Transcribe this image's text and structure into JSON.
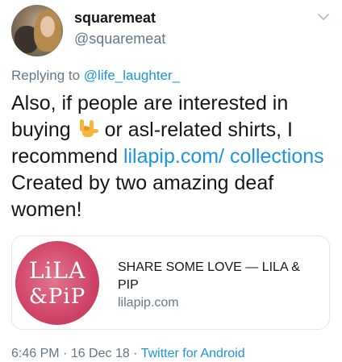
{
  "author": {
    "name": "squaremeat",
    "handle": "@squaremeat"
  },
  "reply": {
    "prefix": "Replying to ",
    "mention": "@life_laughter_"
  },
  "tweet": {
    "part1": "Also, if people are interested in buying ",
    "emoji": "love-you-hand-sign-emoji",
    "part2": " or asl-related shirts, I recommend ",
    "link": "lilapip.com/ collections",
    "part3": " Created by two amazing deaf women!"
  },
  "card": {
    "logo_line1": "LiLA",
    "logo_line2": "&PiP",
    "title": "SHARE SOME LOVE — LILA & PIP",
    "domain": "lilapip.com"
  },
  "meta": {
    "time": "6:46 PM",
    "sep1": " · ",
    "date": "16 Dec 18",
    "sep2": " · ",
    "source": "Twitter for Android"
  },
  "colors": {
    "link": "#1b95e0",
    "secondary": "#657786",
    "card_border": "#e1e8ed",
    "logo_pink": "#d2476a"
  }
}
